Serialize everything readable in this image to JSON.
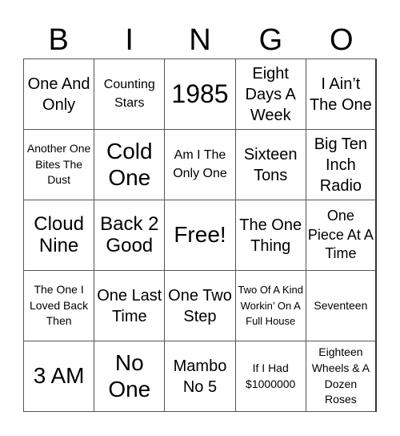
{
  "header": {
    "letters": [
      "B",
      "I",
      "N",
      "G",
      "O"
    ]
  },
  "grid": {
    "rows": [
      [
        "One And Only",
        "Counting Stars",
        "1985",
        "Eight Days A Week",
        "I Ain’t The One"
      ],
      [
        "Another One Bites The Dust",
        "Cold One",
        "Am I The Only One",
        "Sixteen Tons",
        "Big Ten Inch Radio"
      ],
      [
        "Cloud Nine",
        "Back 2 Good",
        "Free!",
        "The One Thing",
        "One Piece At A Time"
      ],
      [
        "The One I Loved Back Then",
        "One Last Time",
        "One Two Step",
        "Two Of A Kind Workin’ On A Full House",
        "Seventeen"
      ],
      [
        "3 AM",
        "No One",
        "Mambo No 5",
        "If I Had $1000000",
        "Eighteen Wheels & A Dozen Roses"
      ]
    ],
    "free_space": "Free!"
  }
}
